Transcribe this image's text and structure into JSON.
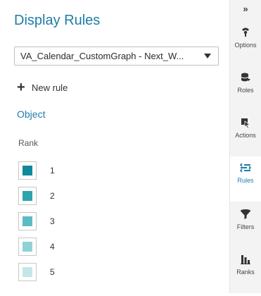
{
  "panel": {
    "title": "Display Rules",
    "dropdown_value": "VA_Calendar_CustomGraph - Next_W...",
    "new_rule_label": "New rule",
    "object_link": "Object",
    "rank_heading": "Rank"
  },
  "ranks": [
    {
      "label": "1",
      "color": "#0e8a9a"
    },
    {
      "label": "2",
      "color": "#2ea4ae"
    },
    {
      "label": "3",
      "color": "#5bbcc3"
    },
    {
      "label": "4",
      "color": "#8fd2d6"
    },
    {
      "label": "5",
      "color": "#c3e7e8"
    }
  ],
  "rail": {
    "collapse_glyph": "»",
    "items": [
      {
        "label": "Options",
        "icon": "options-icon"
      },
      {
        "label": "Roles",
        "icon": "roles-icon"
      },
      {
        "label": "Actions",
        "icon": "actions-icon"
      },
      {
        "label": "Rules",
        "icon": "rules-icon",
        "active": true
      },
      {
        "label": "Filters",
        "icon": "filter-icon"
      },
      {
        "label": "Ranks",
        "icon": "ranks-icon"
      }
    ]
  },
  "colors": {
    "accent": "#1e7ca8",
    "rail_bg": "#f3f3f3"
  }
}
